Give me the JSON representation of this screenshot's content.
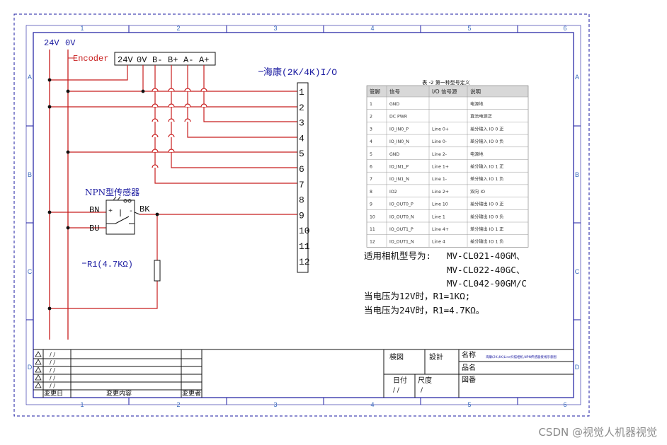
{
  "frame": {
    "top_numbers": [
      "1",
      "2",
      "3",
      "4",
      "5",
      "6"
    ],
    "bottom_numbers": [
      "1",
      "2",
      "3",
      "4",
      "5",
      "6"
    ],
    "left_letters": [
      "A",
      "B",
      "C",
      "D"
    ],
    "right_letters": [
      "A",
      "B",
      "C",
      "D"
    ]
  },
  "power": {
    "v24": "24V",
    "v0": "0V"
  },
  "encoder": {
    "label": "Encoder",
    "pins": [
      "24V",
      "0V",
      "B-",
      "B+",
      "A-",
      "A+"
    ]
  },
  "io": {
    "title": "海康(2K/4K)I/O",
    "pins": [
      "1",
      "2",
      "3",
      "4",
      "5",
      "6",
      "7",
      "8",
      "9",
      "10",
      "11",
      "12"
    ]
  },
  "sensor": {
    "title": "NPN型传感器",
    "bn": "BN",
    "bu": "BU",
    "bk": "BK",
    "plus": "+",
    "minus": "-"
  },
  "resistor": {
    "label": "R1(4.7KΩ)"
  },
  "table": {
    "title": "表 -2 第一种型号定义",
    "headers": [
      "管脚",
      "信号",
      "I/O 信号源",
      "说明"
    ],
    "rows": [
      [
        "1",
        "GND",
        "",
        "电源地"
      ],
      [
        "2",
        "DC PWR",
        "",
        "直流电源正"
      ],
      [
        "3",
        "IO_IN0_P",
        "Line 0+",
        "差分输入 IO 0 正"
      ],
      [
        "4",
        "IO_IN0_N",
        "Line 0-",
        "差分输入 IO 0 负"
      ],
      [
        "5",
        "GND",
        "Line 2-",
        "电源地"
      ],
      [
        "6",
        "IO_IN1_P",
        "Line 1+",
        "差分输入 IO 1 正"
      ],
      [
        "7",
        "IO_IN1_N",
        "Line 1-",
        "差分输入 IO 1 负"
      ],
      [
        "8",
        "IO2",
        "Line 2+",
        "双向 IO"
      ],
      [
        "9",
        "IO_OUT0_P",
        "Line 10",
        "差分输出 IO 0 正"
      ],
      [
        "10",
        "IO_OUT0_N",
        "Line 1",
        "差分输出 IO 0 负"
      ],
      [
        "11",
        "IO_OUT1_P",
        "Line 4+",
        "差分输出 IO 1 正"
      ],
      [
        "12",
        "IO_OUT1_N",
        "Line 4",
        "差分输出 IO 1 负"
      ]
    ]
  },
  "notes": {
    "models_prefix": "适用相机型号为:",
    "model1": "MV-CL021-40GM、",
    "model2": "MV-CL022-40GC、",
    "model3": "MV-CL042-90GM/C",
    "v12": "当电压为12V时，R1=1KΩ;",
    "v24": "当电压为24V时，R1=4.7KΩ。"
  },
  "title_block": {
    "revision_marks": [
      "/ /",
      "/ /",
      "/ /",
      "/ /",
      "/ /"
    ],
    "change_day": "変更日",
    "change_content": "変更内容",
    "changer": "変更者",
    "checked": "検図",
    "design": "設計",
    "name": "名称",
    "product_name": "品名",
    "drawing_no": "図番",
    "date": "日付",
    "date_value": "/ /",
    "scale": "尺度",
    "scale_value": "/",
    "name_value": "海康(2K,4K)Line扫描相机,NPN传感器接线示意图"
  },
  "watermark": "CSDN @视觉人机器视觉",
  "colors": {
    "red_wire": "#c81e1e",
    "blue_text": "#1a1aa0",
    "frame": "#1a1aa0",
    "grid_text": "#3a6bbd"
  }
}
